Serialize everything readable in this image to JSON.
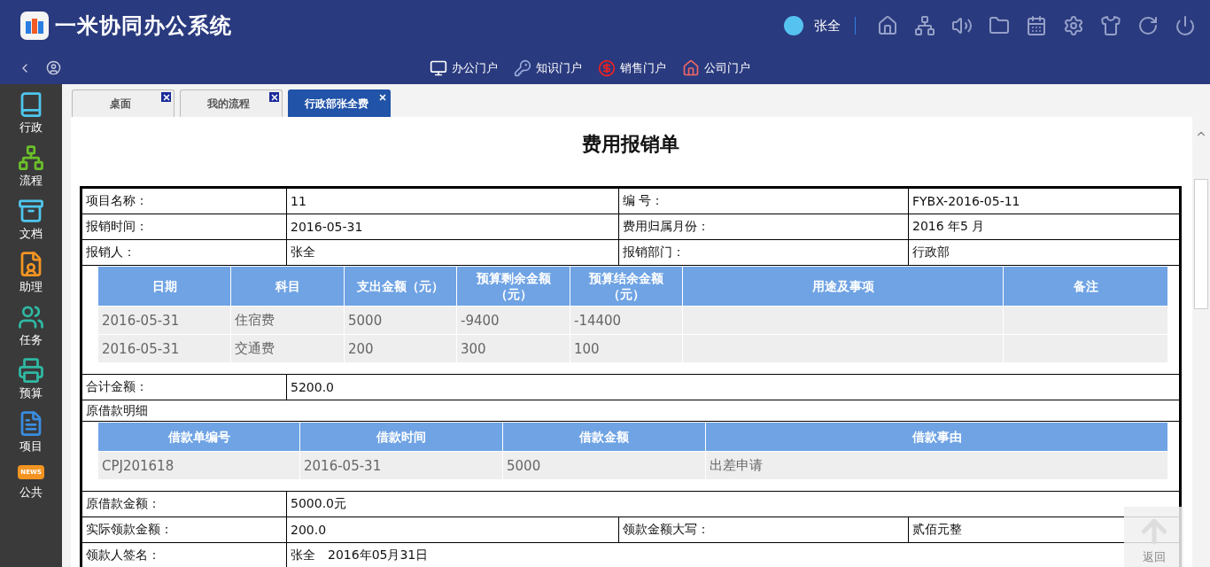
{
  "app": {
    "title": "一米协同办公系统",
    "user": "张全"
  },
  "portals": [
    {
      "kind": "monitor",
      "label": "办公门户"
    },
    {
      "kind": "key",
      "label": "知识门户"
    },
    {
      "kind": "dollar",
      "label": "销售门户"
    },
    {
      "kind": "house",
      "label": "公司门户"
    }
  ],
  "sidebar": {
    "items": [
      {
        "kind": "book",
        "label": "行政"
      },
      {
        "kind": "org",
        "label": "流程"
      },
      {
        "kind": "cabinet",
        "label": "文档"
      },
      {
        "kind": "person",
        "label": "助理"
      },
      {
        "kind": "people",
        "label": "任务"
      },
      {
        "kind": "register",
        "label": "预算"
      },
      {
        "kind": "doc",
        "label": "项目"
      },
      {
        "kind": "news",
        "label": "公共",
        "badge": "NEWS"
      }
    ]
  },
  "tabs": [
    {
      "label": "桌面",
      "selected": false
    },
    {
      "label": "我的流程",
      "selected": false
    },
    {
      "label": "行政部张全费",
      "selected": true
    }
  ],
  "form": {
    "title": "费用报销单",
    "sections": [
      {
        "kind": "pair",
        "cells": [
          "项目名称：",
          "11",
          "编 号：",
          "FYBX-2016-05-11"
        ]
      },
      {
        "kind": "pair",
        "cells": [
          "报销时间：",
          "2016-05-31",
          "费用归属月份：",
          "2016 年5 月"
        ]
      },
      {
        "kind": "pair",
        "cells": [
          "报销人：",
          "张全",
          "报销部门：",
          "行政部"
        ]
      },
      {
        "kind": "subtable",
        "columns": [
          "日期",
          "科目",
          "支出金额（元）",
          "预算剩余金额（元）",
          "预算结余金额（元）",
          "用途及事项",
          "备注"
        ],
        "rows": [
          [
            "2016-05-31",
            "住宿费",
            "5000",
            "-9400",
            "-14400",
            "",
            ""
          ],
          [
            "2016-05-31",
            "交通费",
            "200",
            "300",
            "100",
            "",
            ""
          ]
        ]
      },
      {
        "kind": "single",
        "cells": [
          "合计金额：",
          "5200.0"
        ]
      },
      {
        "kind": "caption",
        "cells": [
          "原借款明细"
        ]
      },
      {
        "kind": "subtable",
        "columns": [
          "借款单编号",
          "借款时间",
          "借款金额",
          "借款事由"
        ],
        "rows": [
          [
            "CPJ201618",
            "2016-05-31",
            "5000",
            "出差申请"
          ]
        ]
      },
      {
        "kind": "single",
        "cells": [
          "原借款金额：",
          "5000.0元"
        ]
      },
      {
        "kind": "pair",
        "cells": [
          "实际领款金额：",
          "200.0",
          "领款金额大写：",
          "贰佰元整"
        ]
      },
      {
        "kind": "single",
        "cells": [
          "领款人签名：",
          "张全　2016年05月31日"
        ]
      }
    ]
  },
  "back_to_top": {
    "label": "返回"
  }
}
